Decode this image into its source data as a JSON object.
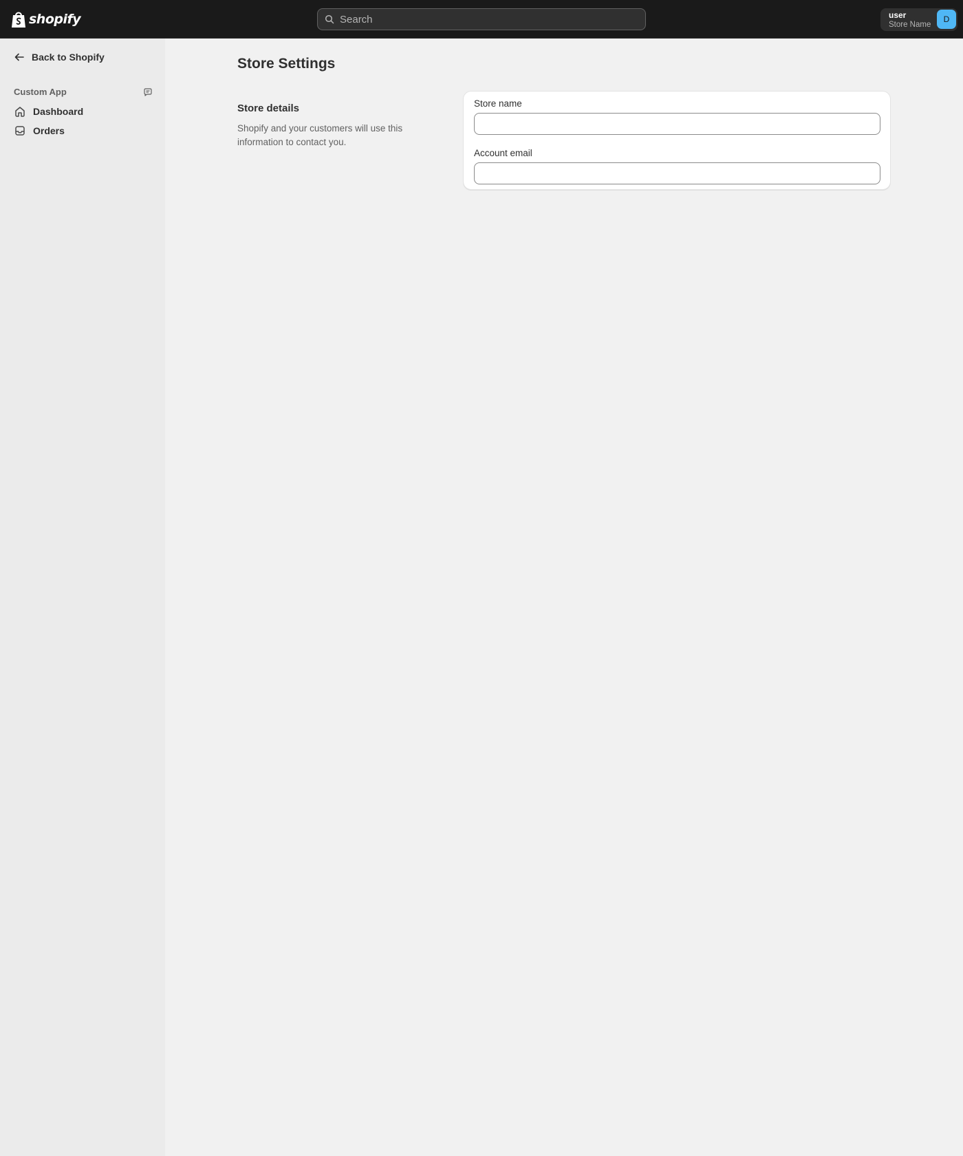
{
  "topbar": {
    "logo_text": "shopify",
    "search": {
      "placeholder": "Search",
      "value": ""
    },
    "account": {
      "user": "user",
      "store": "Store Name",
      "avatar_initial": "D"
    }
  },
  "sidebar": {
    "back_label": "Back to Shopify",
    "app_name": "Custom App",
    "items": [
      {
        "label": "Dashboard",
        "icon": "home-icon"
      },
      {
        "label": "Orders",
        "icon": "inbox-icon"
      }
    ]
  },
  "main": {
    "title": "Store Settings",
    "section": {
      "heading": "Store details",
      "description": "Shopify and your customers will use this information to contact you."
    },
    "fields": [
      {
        "label": "Store name",
        "value": ""
      },
      {
        "label": "Account email",
        "value": ""
      }
    ]
  },
  "colors": {
    "topbar_bg": "#1a1a1a",
    "page_bg": "#f1f1f1",
    "sidebar_bg": "#ebebeb",
    "avatar_bg": "#4fb7f5"
  }
}
